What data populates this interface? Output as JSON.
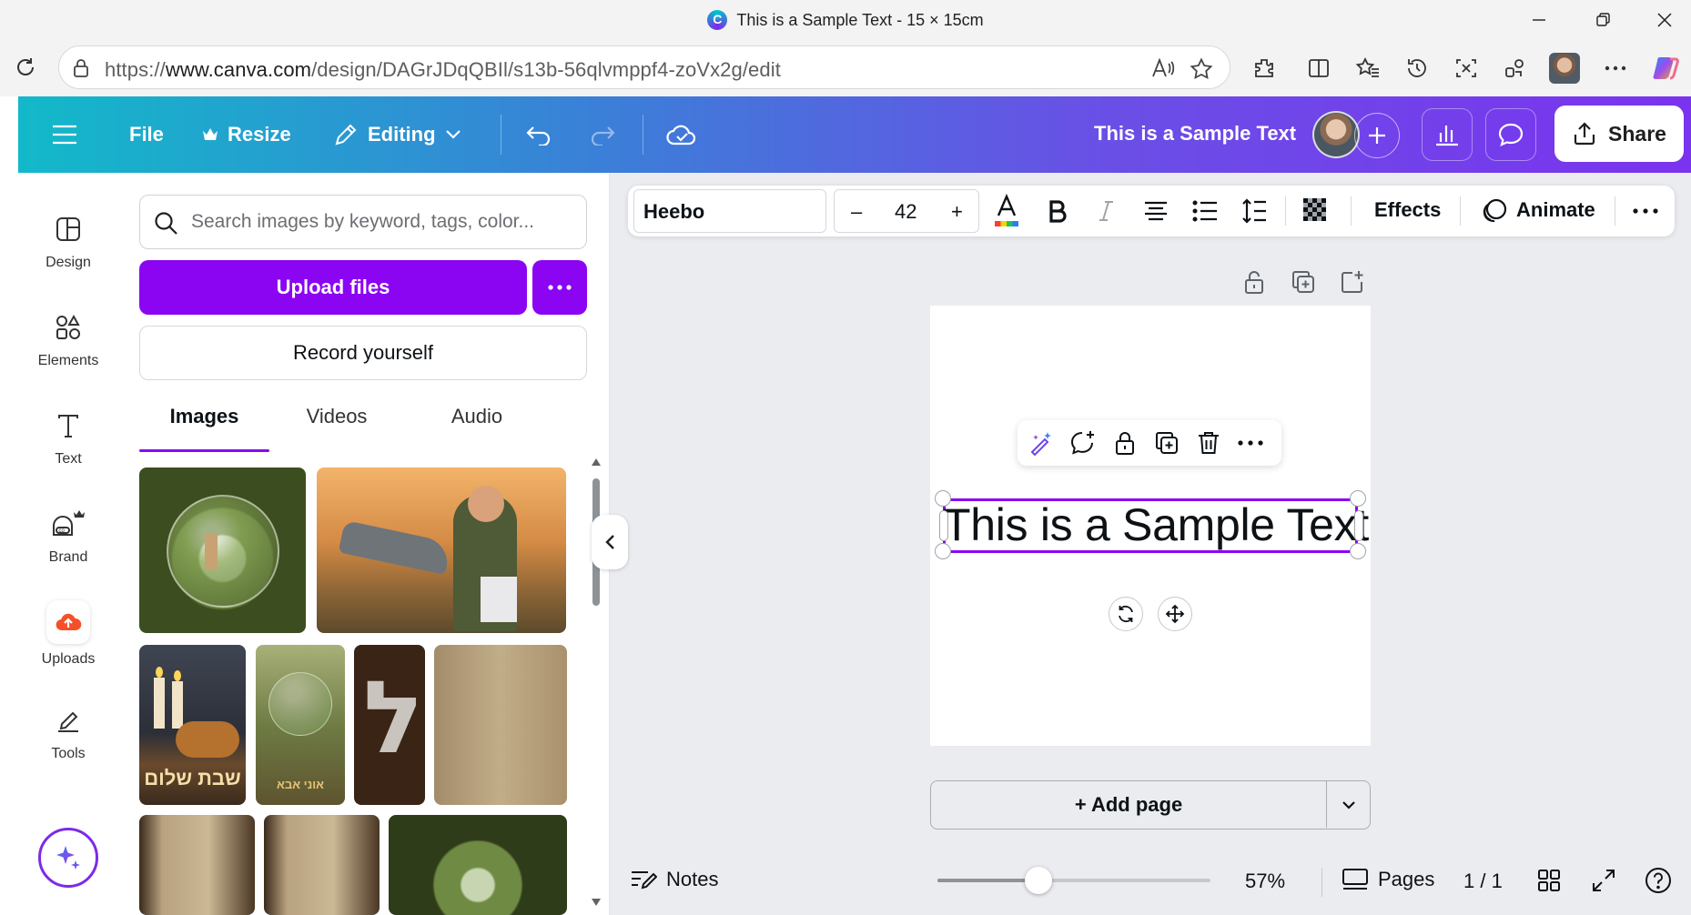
{
  "browser": {
    "tab_title": "This is a Sample Text - 15 × 15cm",
    "url_prefix": "https://",
    "url_host": "www.canva.com",
    "url_path": "/design/DAGrJDqQBIl/s13b-56qlvmppf4-zoVx2g/edit"
  },
  "header": {
    "file_label": "File",
    "resize_label": "Resize",
    "editing_label": "Editing",
    "design_title": "This is a Sample Text",
    "share_label": "Share"
  },
  "rail": {
    "items": [
      {
        "label": "Design",
        "icon": "layout-icon"
      },
      {
        "label": "Elements",
        "icon": "shapes-icon"
      },
      {
        "label": "Text",
        "icon": "text-icon"
      },
      {
        "label": "Brand",
        "icon": "brand-icon"
      },
      {
        "label": "Uploads",
        "icon": "cloud-upload-icon"
      },
      {
        "label": "Tools",
        "icon": "pen-icon"
      }
    ]
  },
  "panel": {
    "search_placeholder": "Search images by keyword, tags, color...",
    "upload_label": "Upload files",
    "record_label": "Record yourself",
    "tabs": [
      "Images",
      "Videos",
      "Audio"
    ],
    "active_tab": "Images",
    "thumb_text_1": "שבת שלום",
    "thumb_text_2": "אוני אבא"
  },
  "toolbar": {
    "font": "Heebo",
    "font_size": "42",
    "minus": "–",
    "plus": "+",
    "effects_label": "Effects",
    "animate_label": "Animate"
  },
  "canvas": {
    "text": "This is a Sample Text",
    "add_page_label": "+ Add page"
  },
  "footer": {
    "notes_label": "Notes",
    "zoom": "57%",
    "zoom_value": 0.37,
    "pages_label": "Pages",
    "page_counter": "1 / 1"
  },
  "colors": {
    "accent": "#8b05f3",
    "header_start": "#12b9c9",
    "header_end": "#7a33ee",
    "workspace_bg": "#ebecf0"
  }
}
